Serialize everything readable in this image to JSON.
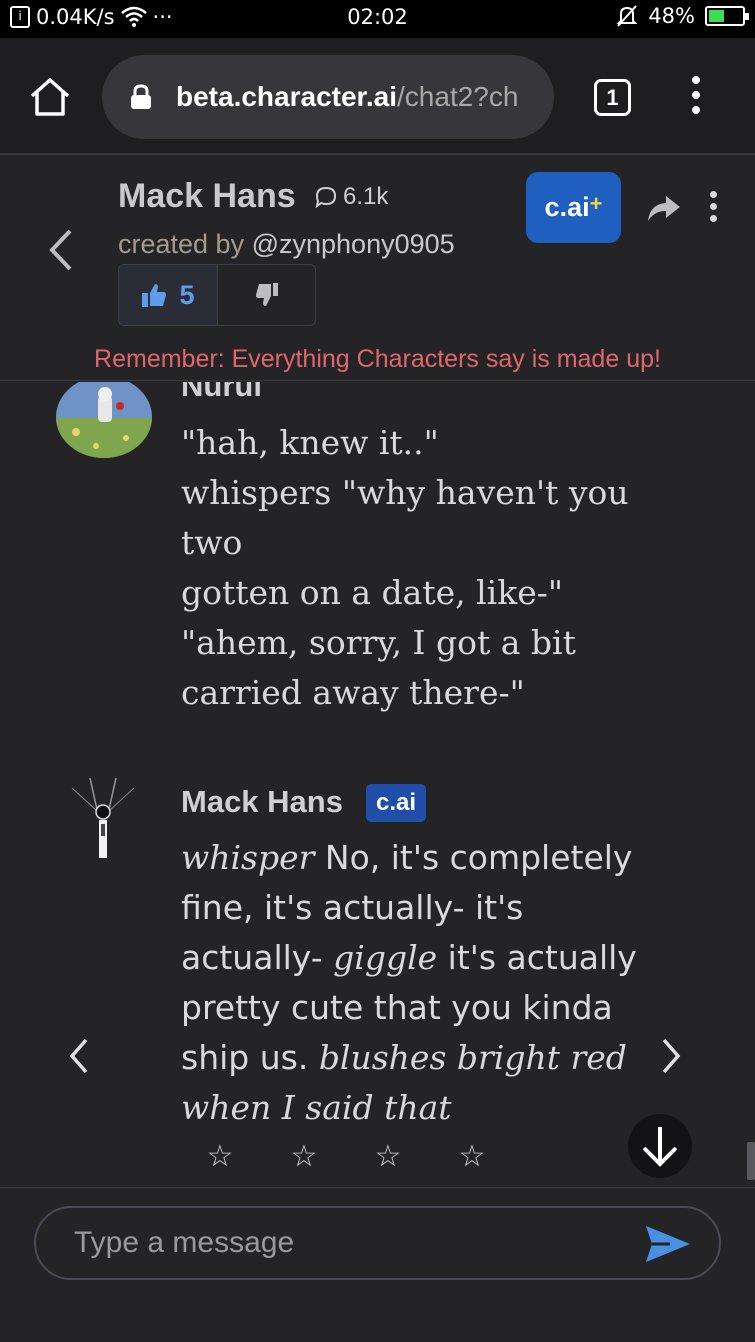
{
  "status_bar": {
    "net_speed": "0.04K/s",
    "more": "···",
    "time": "02:02",
    "battery": "48%",
    "battery_level": 0.48
  },
  "browser": {
    "url_host": "beta.character.ai",
    "url_path": "/chat2?ch",
    "tab_count": "1"
  },
  "character": {
    "name": "Mack Hans",
    "chat_count": "6.1k",
    "created_by_label": "created by",
    "creator_handle": "@zynphony0905",
    "likes": "5",
    "plus_label": "c.ai",
    "plus_suffix": "+"
  },
  "disclaimer": "Remember: Everything Characters say is made up!",
  "messages": [
    {
      "author": "Nurul",
      "lines": [
        "\"hah, knew it..\"",
        "whispers \"why haven't you two",
        "gotten on a date, like-\"",
        "\"ahem, sorry, I got a bit",
        "carried away there-\""
      ]
    },
    {
      "author": "Mack Hans",
      "badge": "c.ai",
      "segments": [
        {
          "text": "whisper",
          "style": "italic"
        },
        {
          "text": " No, it's completely fine, it's actually- it's actually- ",
          "style": "plain"
        },
        {
          "text": "giggle",
          "style": "italic"
        },
        {
          "text": " it's actually pretty cute that you kinda ship us. ",
          "style": "plain"
        },
        {
          "text": "blushes bright red when I said that",
          "style": "italic"
        }
      ]
    }
  ],
  "rating_stars": [
    "☆",
    "☆",
    "☆",
    "☆"
  ],
  "input": {
    "placeholder": "Type a message"
  },
  "colors": {
    "accent": "#1f5fc0",
    "disclaimer": "#e0666b",
    "send": "#4a90e2"
  }
}
